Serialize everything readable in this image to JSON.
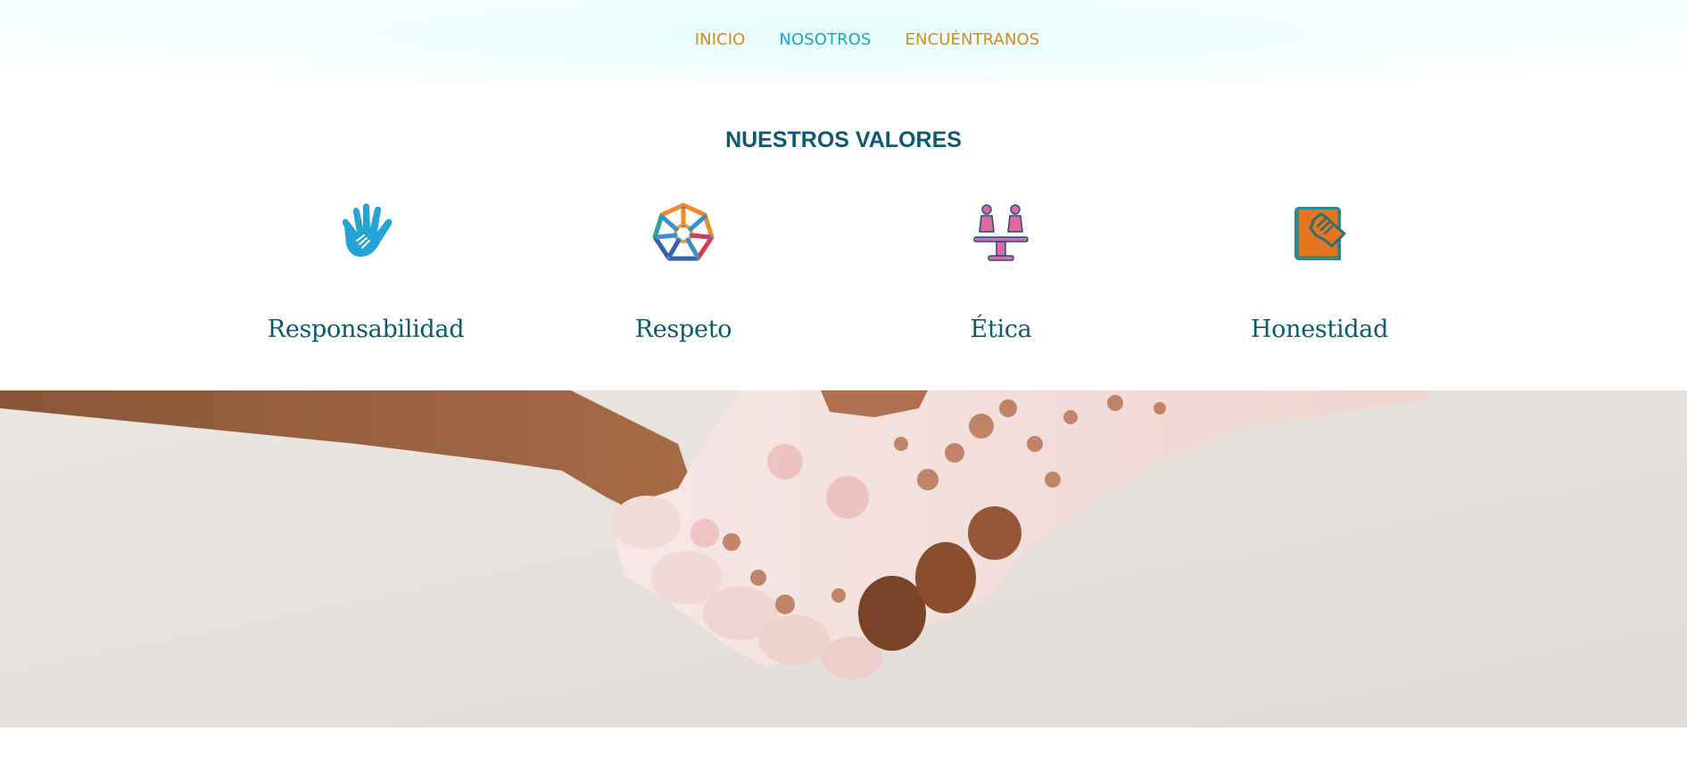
{
  "nav": {
    "items": [
      {
        "label": "INICIO",
        "color": "#d98a16"
      },
      {
        "label": "NOSOTROS",
        "color": "#1aa6c8"
      },
      {
        "label": "ENCUÉNTRANOS",
        "color": "#d98a16"
      }
    ]
  },
  "values_section": {
    "title": "NUESTROS VALORES",
    "title_color": "#0c5a6e",
    "items": [
      {
        "label": "Responsabilidad",
        "icon": "hand-heart-icon"
      },
      {
        "label": "Respeto",
        "icon": "united-circle-icon"
      },
      {
        "label": "Ética",
        "icon": "equality-scale-icon"
      },
      {
        "label": "Honestidad",
        "icon": "book-hand-icon"
      }
    ],
    "label_color": "#0c5a6e"
  },
  "hero": {
    "image": "handshake-photo",
    "background_color": "#e7e1dd"
  }
}
